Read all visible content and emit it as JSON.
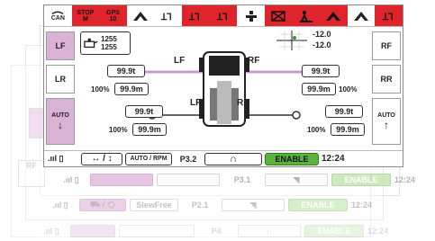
{
  "topbar": {
    "items": [
      {
        "label": "CAN",
        "icon": "can-icon",
        "alarm": false
      },
      {
        "label": "STOP\nM",
        "icon": "",
        "alarm": true
      },
      {
        "label": "GPS\n10",
        "icon": "",
        "alarm": true
      },
      {
        "label": "",
        "icon": "slope-warning-icon",
        "alarm": false
      },
      {
        "label": "",
        "icon": "tilt-indicator-icon",
        "alarm": false
      },
      {
        "label": "",
        "icon": "tilt-alarm-icon",
        "alarm": true
      },
      {
        "label": "",
        "icon": "slope-alarm-icon",
        "alarm": true
      },
      {
        "label": "",
        "icon": "operator-icon",
        "alarm": false
      },
      {
        "label": "",
        "icon": "crossed-box-icon",
        "alarm": true
      },
      {
        "label": "",
        "icon": "person-alarm-icon",
        "alarm": true
      },
      {
        "label": "",
        "icon": "hazard-icon",
        "alarm": true
      },
      {
        "label": "",
        "icon": "slope-warning-icon",
        "alarm": false
      },
      {
        "label": "",
        "icon": "tilt-alarm-icon",
        "alarm": true
      }
    ]
  },
  "left_tabs": {
    "lf": "LF",
    "lr": "LR",
    "auto_down": "AUTO"
  },
  "right_tabs": {
    "rf": "RF",
    "rr": "RR",
    "auto_up": "AUTO"
  },
  "load_box": {
    "top": "1255",
    "bottom": "1255"
  },
  "tilt": {
    "x": "-12.0",
    "y": "-12.0"
  },
  "diagram": {
    "lf": "LF",
    "rf": "RF",
    "lr": "LR",
    "rr": "RR"
  },
  "lf": {
    "load": "99.9t",
    "pct": "100%",
    "dist": "99.9m"
  },
  "rf": {
    "load": "99.9t",
    "pct": "100%",
    "dist": "99.9m"
  },
  "lr": {
    "load": "99.9t",
    "pct": "100%",
    "dist": "99.9m"
  },
  "rr": {
    "load": "99.9t",
    "pct": "100%",
    "dist": "99.9m"
  },
  "statusbar": {
    "mode": "AUTO / RPM",
    "page": "P3.2",
    "enable": "ENABLE",
    "time": "12:24"
  },
  "layer2": {
    "page": "P3.1",
    "enable": "ENABLE",
    "time": "12:24"
  },
  "layer3": {
    "mode": "SlewFree",
    "page": "P2.1",
    "enable": "ENABLE",
    "time": "12:24"
  },
  "layer4": {
    "page": "P4",
    "enable": "ENABLE",
    "time": "12:24"
  },
  "colors": {
    "alarm": "#e0242b",
    "enable": "#5bb33c",
    "selected": "#d9b2d6"
  }
}
